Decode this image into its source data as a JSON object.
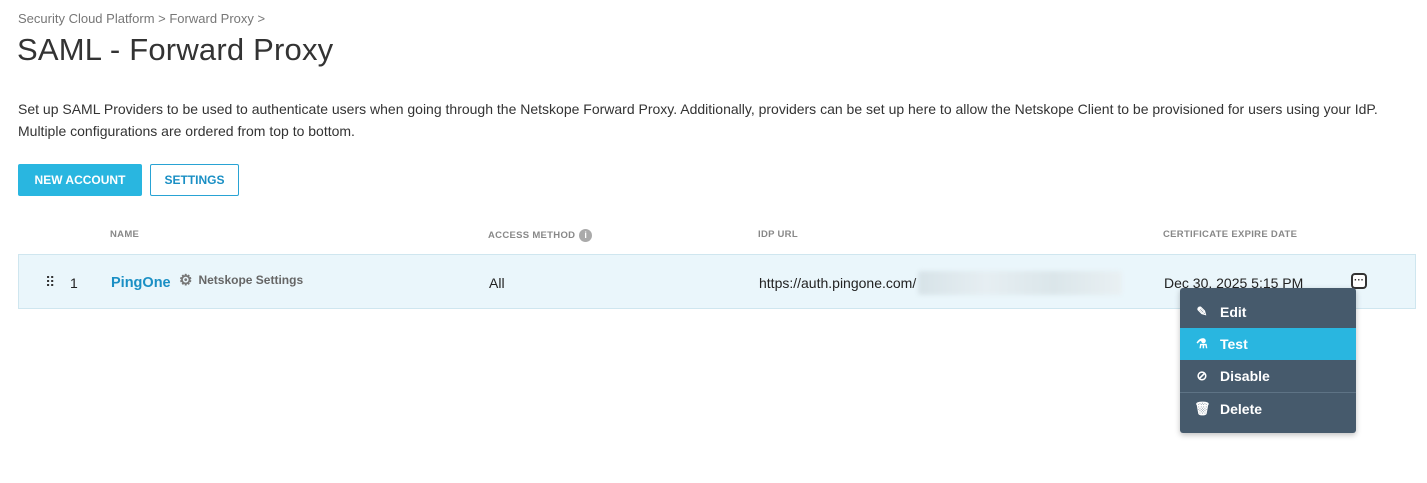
{
  "breadcrumb": "Security Cloud Platform > Forward Proxy >",
  "page_title": "SAML - Forward Proxy",
  "description": "Set up SAML Providers to be used to authenticate users when going through the Netskope Forward Proxy. Additionally, providers can be set up here to allow the Netskope Client to be provisioned for users using your IdP. Multiple configurations are ordered from top to bottom.",
  "buttons": {
    "new_account": "NEW ACCOUNT",
    "settings": "SETTINGS"
  },
  "table": {
    "headers": {
      "name": "NAME",
      "access_method": "ACCESS METHOD",
      "idp_url": "IDP URL",
      "cert_expire": "CERTIFICATE EXPIRE DATE"
    },
    "rows": [
      {
        "index": "1",
        "name": "PingOne",
        "settings_link": "Netskope Settings",
        "access_method": "All",
        "idp_url": "https://auth.pingone.com/",
        "cert_expire": "Dec 30, 2025 5:15 PM"
      }
    ]
  },
  "context_menu": {
    "items": [
      {
        "label": "Edit",
        "icon": "pencil-icon"
      },
      {
        "label": "Test",
        "icon": "flask-icon"
      },
      {
        "label": "Disable",
        "icon": "ban-icon"
      },
      {
        "label": "Delete",
        "icon": "trash-icon"
      }
    ],
    "active": "Test"
  },
  "colors": {
    "accent": "#29b6e0",
    "link": "#1a8fc4",
    "menu_bg": "#465a6c",
    "row_bg": "#eaf6fb"
  }
}
